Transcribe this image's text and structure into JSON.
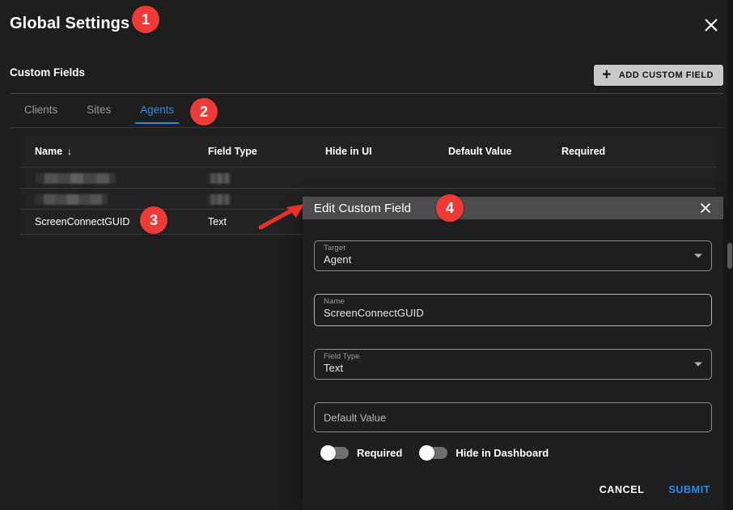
{
  "window": {
    "title": "Global Settings",
    "close_icon": "close-icon"
  },
  "section": {
    "title": "Custom Fields",
    "add_button_label": "ADD CUSTOM FIELD",
    "add_button_icon": "plus-icon"
  },
  "tabs": [
    {
      "label": "Clients",
      "active": false
    },
    {
      "label": "Sites",
      "active": false
    },
    {
      "label": "Agents",
      "active": true
    }
  ],
  "table": {
    "columns": [
      "Name",
      "Field Type",
      "Hide in UI",
      "Default Value",
      "Required"
    ],
    "sort_column": "Name",
    "sort_direction_icon": "arrow-down-icon",
    "rows": [
      {
        "name": "",
        "field_type": "",
        "hide_in_ui": "",
        "default_value": "",
        "required": "",
        "redacted": true
      },
      {
        "name": "",
        "field_type": "",
        "hide_in_ui": "",
        "default_value": "",
        "required": "",
        "redacted": true
      },
      {
        "name": "ScreenConnectGUID",
        "field_type": "Text",
        "hide_in_ui": "",
        "default_value": "",
        "required": "",
        "redacted": false
      }
    ]
  },
  "dialog": {
    "title": "Edit Custom Field",
    "close_icon": "close-icon",
    "fields": {
      "target": {
        "label": "Target",
        "value": "Agent",
        "caret_icon": "chevron-down-icon"
      },
      "name": {
        "label": "Name",
        "value": "ScreenConnectGUID"
      },
      "field_type": {
        "label": "Field Type",
        "value": "Text",
        "caret_icon": "chevron-down-icon"
      },
      "default_value": {
        "label": "Default Value",
        "placeholder": "Default Value",
        "value": ""
      }
    },
    "toggles": [
      {
        "label": "Required",
        "on": false
      },
      {
        "label": "Hide in Dashboard",
        "on": false
      }
    ],
    "actions": {
      "cancel_label": "CANCEL",
      "submit_label": "SUBMIT"
    }
  },
  "annotations": [
    {
      "id": "1",
      "label": "1",
      "target": "page-title"
    },
    {
      "id": "2",
      "label": "2",
      "target": "tab-agents"
    },
    {
      "id": "3",
      "label": "3",
      "target": "row-screenconnectguid"
    },
    {
      "id": "4",
      "label": "4",
      "target": "dialog-title"
    }
  ],
  "colors": {
    "accent_blue": "#2f8ce0",
    "annotation_red": "#ef3b38",
    "page_background": "#1e1e1e",
    "dialog_titlebar": "#4c4c4c",
    "button_grey": "#c9c9c9"
  }
}
